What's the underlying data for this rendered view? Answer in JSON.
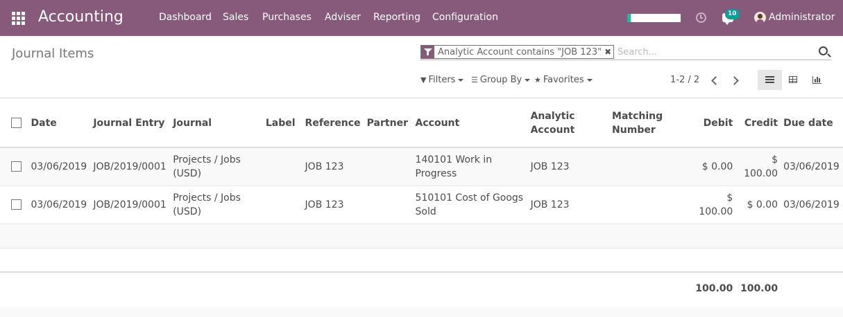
{
  "app": {
    "title": "Accounting"
  },
  "nav": {
    "menu": [
      "Dashboard",
      "Sales",
      "Purchases",
      "Adviser",
      "Reporting",
      "Configuration"
    ],
    "progress_fraction": 0.06,
    "messages_badge": "10",
    "user": "Administrator"
  },
  "control_panel": {
    "title": "Journal Items",
    "facet": "Analytic Account contains \"JOB 123\"",
    "facet_close": "✖",
    "search_placeholder": "Search...",
    "filters_label": "Filters",
    "groupby_label": "Group By",
    "favorites_label": "Favorites",
    "pager": "1-2 / 2"
  },
  "table": {
    "columns": {
      "date": "Date",
      "journal_entry": "Journal Entry",
      "journal": "Journal",
      "label": "Label",
      "reference": "Reference",
      "partner": "Partner",
      "account": "Account",
      "analytic_1": "Analytic",
      "analytic_2": "Account",
      "matching_1": "Matching",
      "matching_2": "Number",
      "debit": "Debit",
      "credit": "Credit",
      "due_date": "Due date"
    },
    "rows": [
      {
        "date": "03/06/2019",
        "journal_entry": "JOB/2019/0001",
        "journal_1": "Projects / Jobs",
        "journal_2": "(USD)",
        "label": "",
        "reference": "JOB 123",
        "partner": "",
        "account_1": "140101 Work in",
        "account_2": "Progress",
        "analytic": "JOB 123",
        "matching": "",
        "debit": "$ 0.00",
        "credit": "$ 100.00",
        "due_date": "03/06/2019"
      },
      {
        "date": "03/06/2019",
        "journal_entry": "JOB/2019/0001",
        "journal_1": "Projects / Jobs",
        "journal_2": "(USD)",
        "label": "",
        "reference": "JOB 123",
        "partner": "",
        "account_1": "510101 Cost of Googs",
        "account_2": "Sold",
        "analytic": "JOB 123",
        "matching": "",
        "debit": "$ 100.00",
        "credit": "$ 0.00",
        "due_date": "03/06/2019"
      }
    ],
    "totals": {
      "debit": "100.00",
      "credit": "100.00"
    }
  }
}
